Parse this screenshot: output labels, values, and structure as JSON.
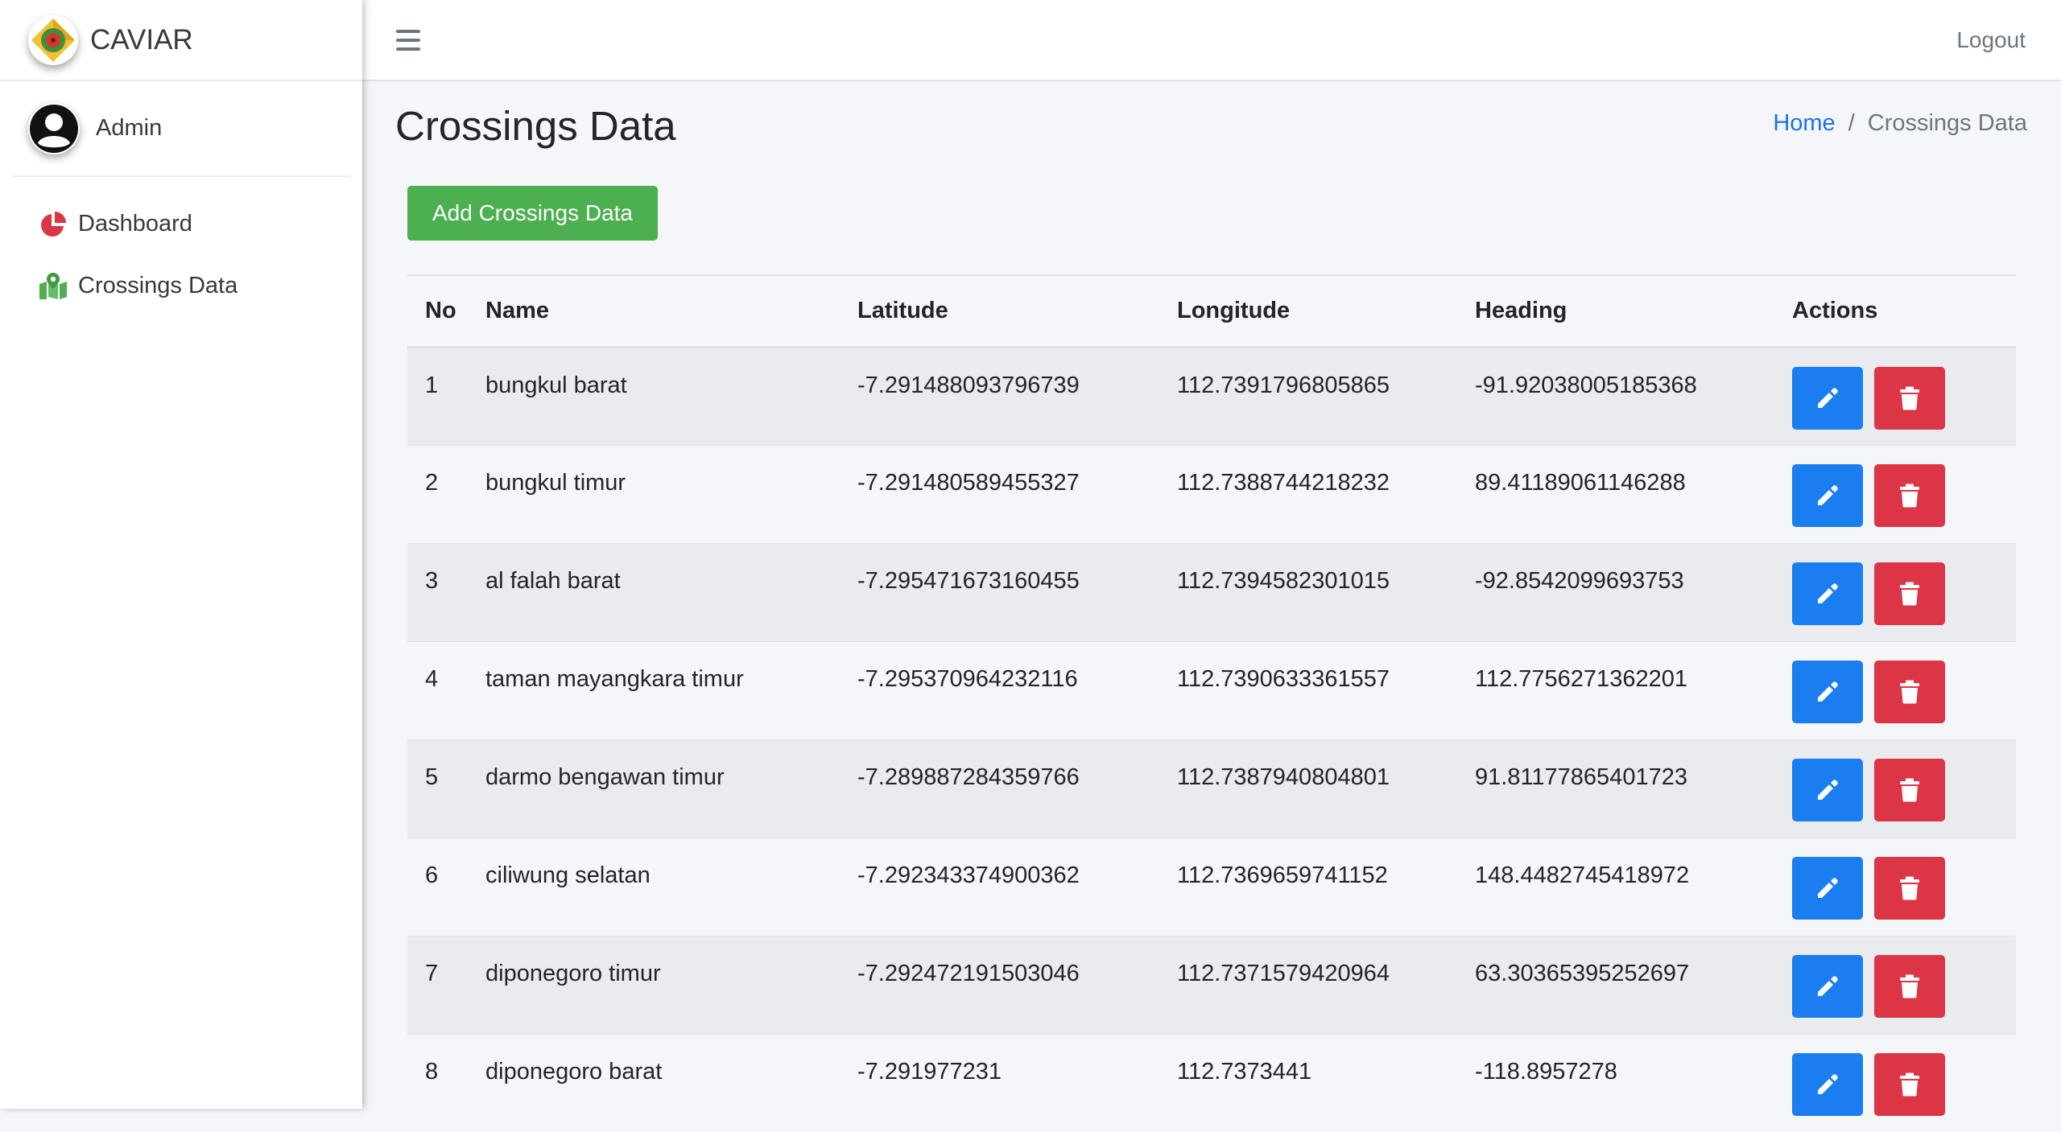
{
  "brand": {
    "name": "CAVIAR"
  },
  "user": {
    "name": "Admin"
  },
  "sidebar": {
    "items": [
      {
        "label": "Dashboard",
        "icon": "chart-pie-icon"
      },
      {
        "label": "Crossings Data",
        "icon": "map-marked-icon"
      }
    ]
  },
  "topbar": {
    "logout_label": "Logout"
  },
  "page": {
    "title": "Crossings Data",
    "breadcrumb": {
      "home": "Home",
      "separator": "/",
      "current": "Crossings Data"
    },
    "add_button_label": "Add Crossings Data"
  },
  "table": {
    "headers": {
      "no": "No",
      "name": "Name",
      "latitude": "Latitude",
      "longitude": "Longitude",
      "heading": "Heading",
      "actions": "Actions"
    },
    "rows": [
      {
        "no": "1",
        "name": "bungkul barat",
        "latitude": "-7.291488093796739",
        "longitude": "112.7391796805865",
        "heading": "-91.92038005185368"
      },
      {
        "no": "2",
        "name": "bungkul timur",
        "latitude": "-7.291480589455327",
        "longitude": "112.7388744218232",
        "heading": "89.41189061146288"
      },
      {
        "no": "3",
        "name": "al falah barat",
        "latitude": "-7.295471673160455",
        "longitude": "112.7394582301015",
        "heading": "-92.8542099693753"
      },
      {
        "no": "4",
        "name": "taman mayangkara timur",
        "latitude": "-7.295370964232116",
        "longitude": "112.7390633361557",
        "heading": "112.7756271362201"
      },
      {
        "no": "5",
        "name": "darmo bengawan timur",
        "latitude": "-7.289887284359766",
        "longitude": "112.7387940804801",
        "heading": "91.81177865401723"
      },
      {
        "no": "6",
        "name": "ciliwung selatan",
        "latitude": "-7.292343374900362",
        "longitude": "112.7369659741152",
        "heading": "148.4482745418972"
      },
      {
        "no": "7",
        "name": "diponegoro timur",
        "latitude": "-7.292472191503046",
        "longitude": "112.7371579420964",
        "heading": "63.30365395252697"
      },
      {
        "no": "8",
        "name": "diponegoro barat",
        "latitude": "-7.291977231",
        "longitude": "112.7373441",
        "heading": "-118.8957278"
      }
    ]
  },
  "colors": {
    "add_button": "#4caf50",
    "edit_button": "#1a7ef0",
    "delete_button": "#dc3545",
    "link": "#1a73e8"
  }
}
